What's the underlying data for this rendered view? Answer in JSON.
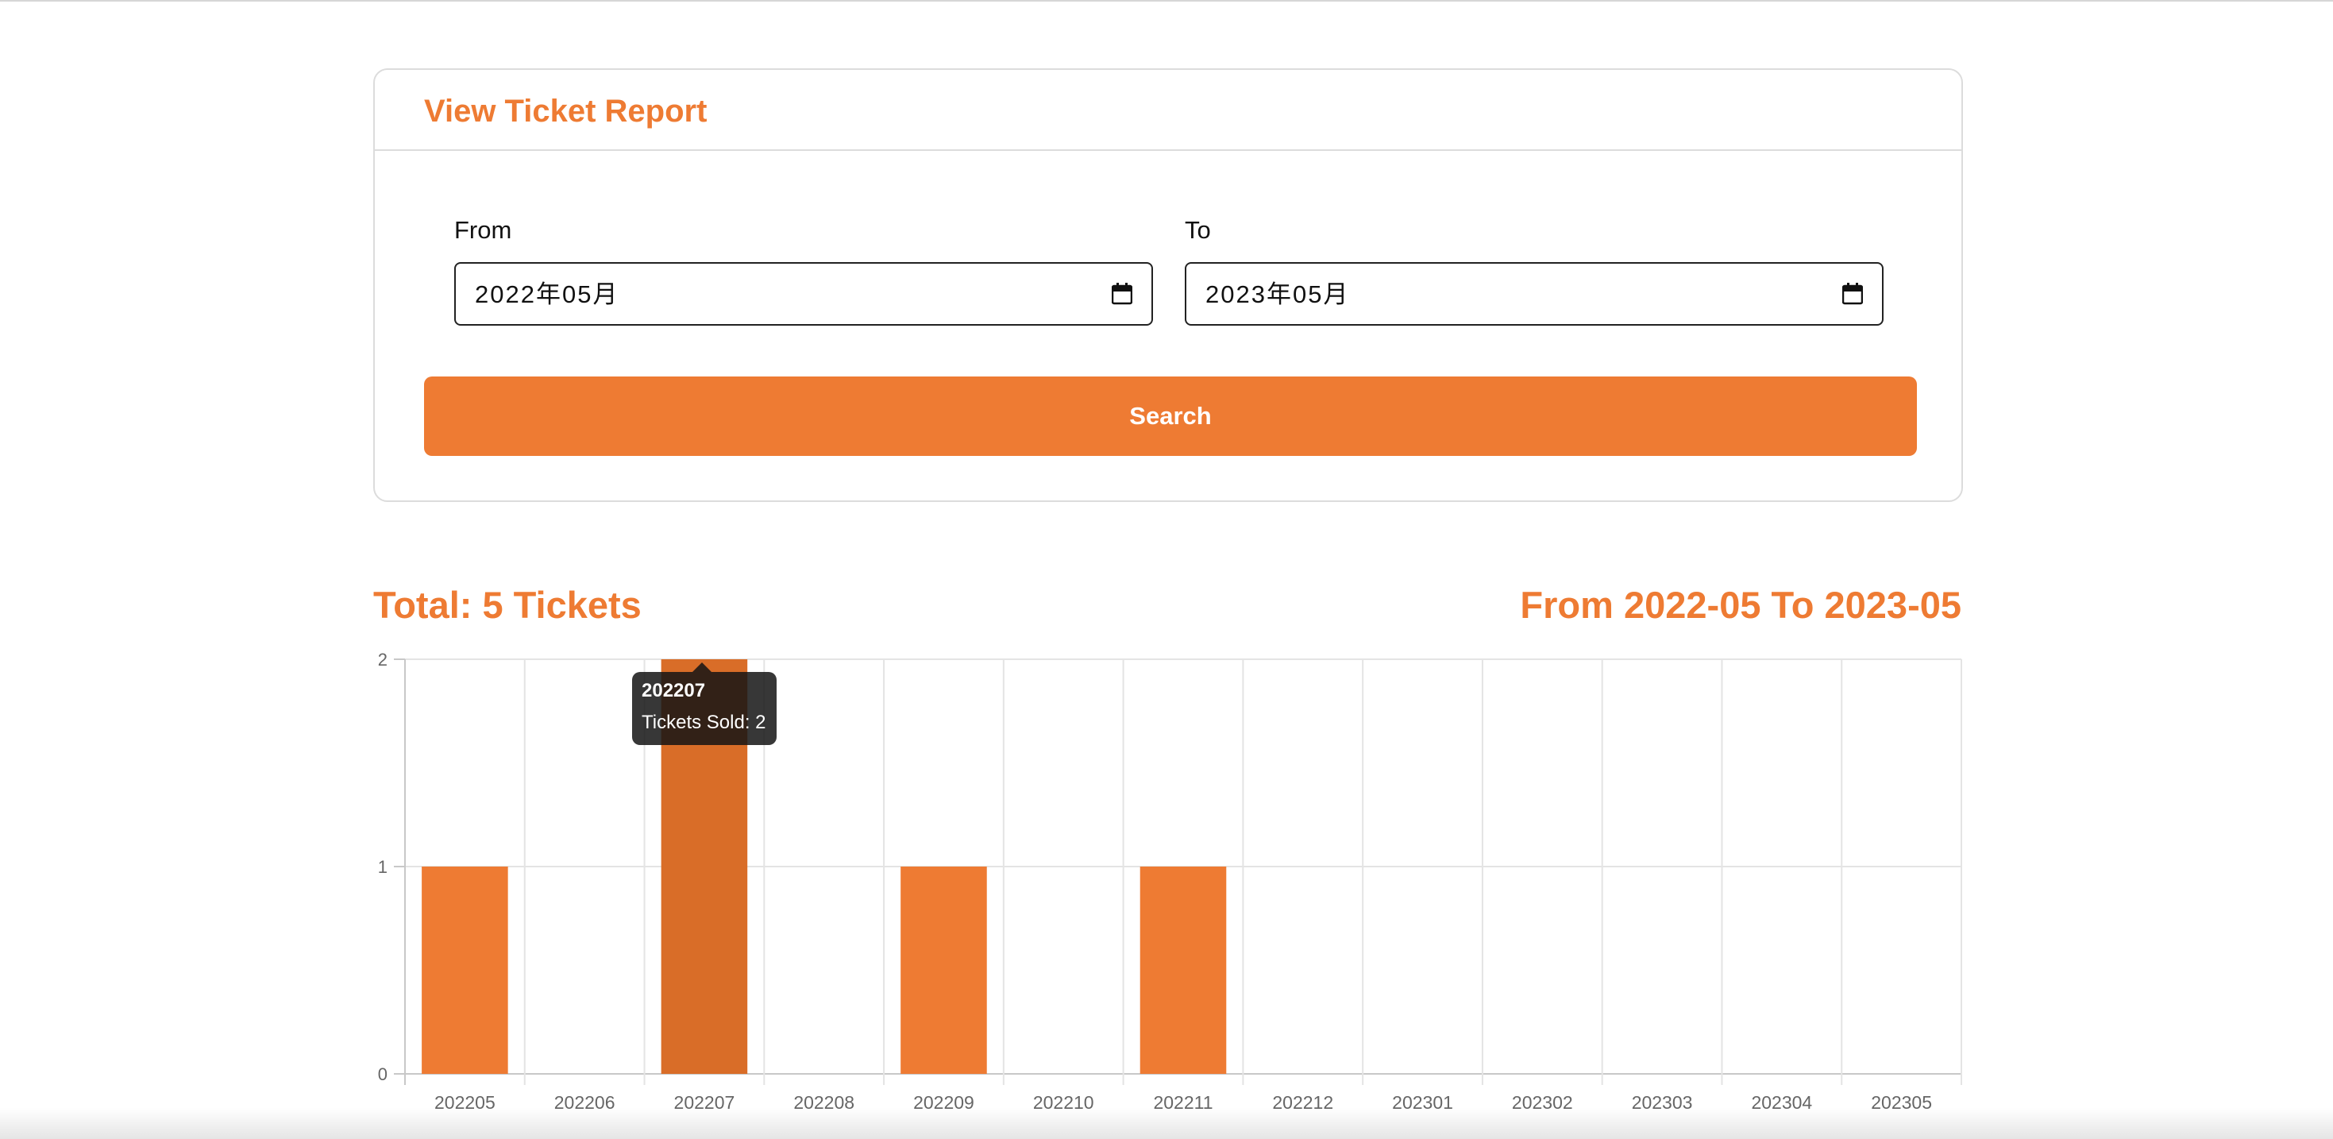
{
  "report_card": {
    "title": "View Ticket Report",
    "from_label": "From",
    "from_value": "2022年05月",
    "to_label": "To",
    "to_value": "2023年05月",
    "search_label": "Search"
  },
  "summary": {
    "total": "Total: 5 Tickets",
    "range": "From 2022-05 To 2023-05"
  },
  "colors": {
    "accent": "#ee7b33",
    "bar_hover": "#d96d28"
  },
  "tooltip": {
    "title": "202207",
    "body": "Tickets Sold: 2"
  },
  "chart_data": {
    "type": "bar",
    "categories": [
      "202205",
      "202206",
      "202207",
      "202208",
      "202209",
      "202210",
      "202211",
      "202212",
      "202301",
      "202302",
      "202303",
      "202304",
      "202305"
    ],
    "series": [
      {
        "name": "Tickets Sold",
        "values": [
          1,
          0,
          2,
          0,
          1,
          0,
          1,
          0,
          0,
          0,
          0,
          0,
          0
        ]
      }
    ],
    "yticks": [
      "0",
      "1",
      "2"
    ],
    "ylim": [
      0,
      2
    ],
    "grid": true,
    "legend": "none",
    "highlighted_category": "202207"
  }
}
